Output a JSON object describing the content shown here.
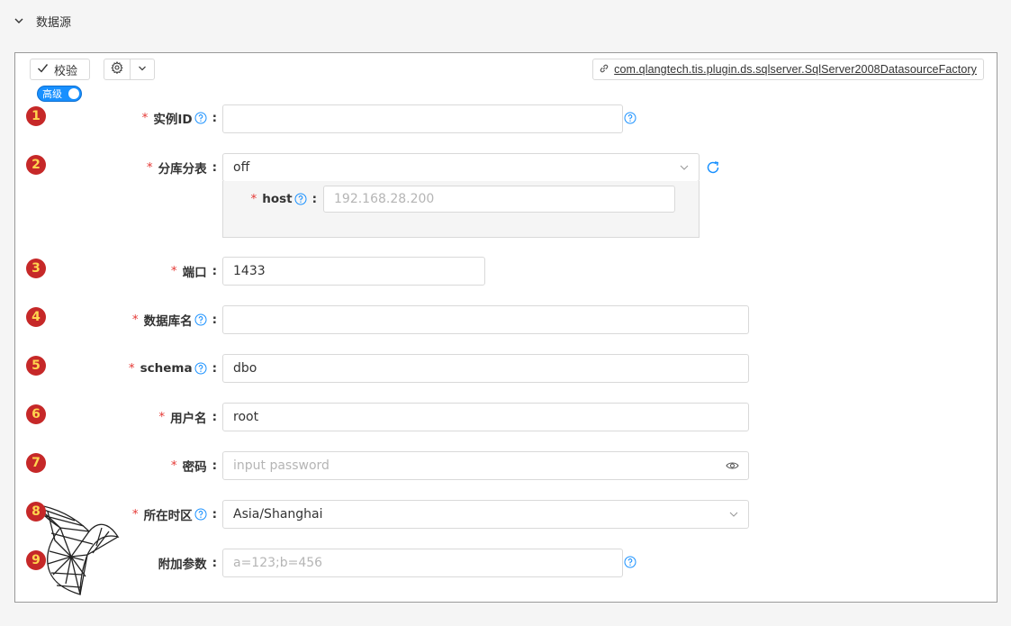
{
  "section": {
    "title": "数据源",
    "icon": "chevron-down-icon"
  },
  "toolbar": {
    "validate_label": "校验",
    "gear_icon": "gear-icon",
    "dropdown_icon": "chevron-down-icon",
    "plugin_link": "com.qlangtech.tis.plugin.ds.sqlserver.SqlServer2008DatasourceFactory",
    "advanced_toggle": {
      "label": "高级",
      "on": true
    }
  },
  "fields": [
    {
      "badge": "1",
      "label": "实例ID",
      "required": true,
      "help": true,
      "value": "",
      "placeholder": "",
      "trailing_help": true
    },
    {
      "badge": "2",
      "label": "分库分表",
      "required": true,
      "help": false,
      "value": "off",
      "type": "select",
      "refresh_icon": "refresh-icon",
      "sub": {
        "label": "host",
        "required": true,
        "help": true,
        "value": "",
        "placeholder": "192.168.28.200"
      }
    },
    {
      "badge": "3",
      "label": "端口",
      "required": true,
      "help": false,
      "value": "1433"
    },
    {
      "badge": "4",
      "label": "数据库名",
      "required": true,
      "help": true,
      "value": ""
    },
    {
      "badge": "5",
      "label": "schema",
      "required": true,
      "help": true,
      "value": "dbo"
    },
    {
      "badge": "6",
      "label": "用户名",
      "required": true,
      "help": false,
      "value": "root"
    },
    {
      "badge": "7",
      "label": "密码",
      "required": true,
      "help": false,
      "value": "",
      "placeholder": "input password",
      "type": "password"
    },
    {
      "badge": "8",
      "label": "所在时区",
      "required": true,
      "help": true,
      "value": "Asia/Shanghai",
      "type": "select"
    },
    {
      "badge": "9",
      "label": "附加参数",
      "required": false,
      "help": false,
      "value": "",
      "placeholder": "a=123;b=456",
      "trailing_help": true
    }
  ],
  "colors": {
    "accent": "#1890ff",
    "required": "#e53935",
    "badge_bg": "#c62828",
    "badge_fg": "#ffd54f"
  }
}
